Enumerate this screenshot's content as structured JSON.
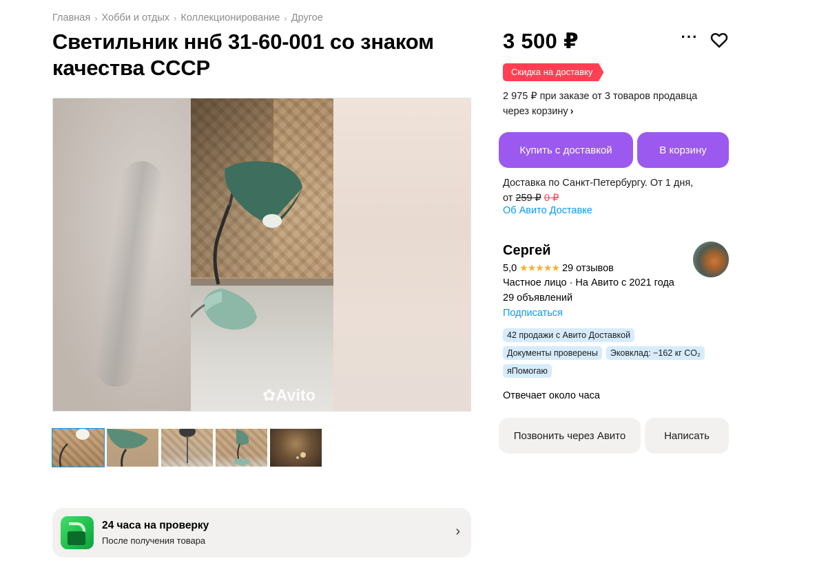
{
  "breadcrumb": [
    "Главная",
    "Хобби и отдых",
    "Коллекционирование",
    "Другое"
  ],
  "breadcrumb_separator": "›",
  "title": "Светильник ннб 31-60-001 со знаком качества СССР",
  "gallery": {
    "watermark": "Avito",
    "thumbnail_count": 5,
    "active_thumbnail": 1
  },
  "inspection": {
    "title": "24 часа на проверку",
    "subtitle": "После получения товара",
    "chevron": "›"
  },
  "price": "3 500 ₽",
  "more_label": "···",
  "promo_badge": "Скидка на доставку",
  "basket_price": {
    "text": "2 975 ₽ при заказе от 3 товаров продавца через корзину",
    "chevron": "›"
  },
  "buttons": {
    "buy": "Купить с доставкой",
    "cart": "В корзину",
    "call": "Позвонить через Авито",
    "write": "Написать"
  },
  "delivery": {
    "text": "Доставка по Санкт-Петербургу. От 1 дня,",
    "from": "от",
    "old_price": "259 ₽",
    "new_price": "0 ₽",
    "link": "Об Авито Доставке"
  },
  "seller": {
    "name": "Сергей",
    "rating": "5,0",
    "stars": "★★★★★",
    "reviews": "29 отзывов",
    "type": "Частное лицо · На Авито с 2021 года",
    "ads": "29 объявлений",
    "subscribe": "Подписаться",
    "badges": [
      "42 продажи с Авито Доставкой",
      "Документы проверены",
      "Эковклад: −162 кг CO₂",
      "яПомогаю"
    ],
    "reply_time": "Отвечает около часа"
  },
  "colors": {
    "accent": "#9b59ef",
    "promo": "#ff4053",
    "link": "#0599ff",
    "badge_bg": "#d6ecfc"
  }
}
